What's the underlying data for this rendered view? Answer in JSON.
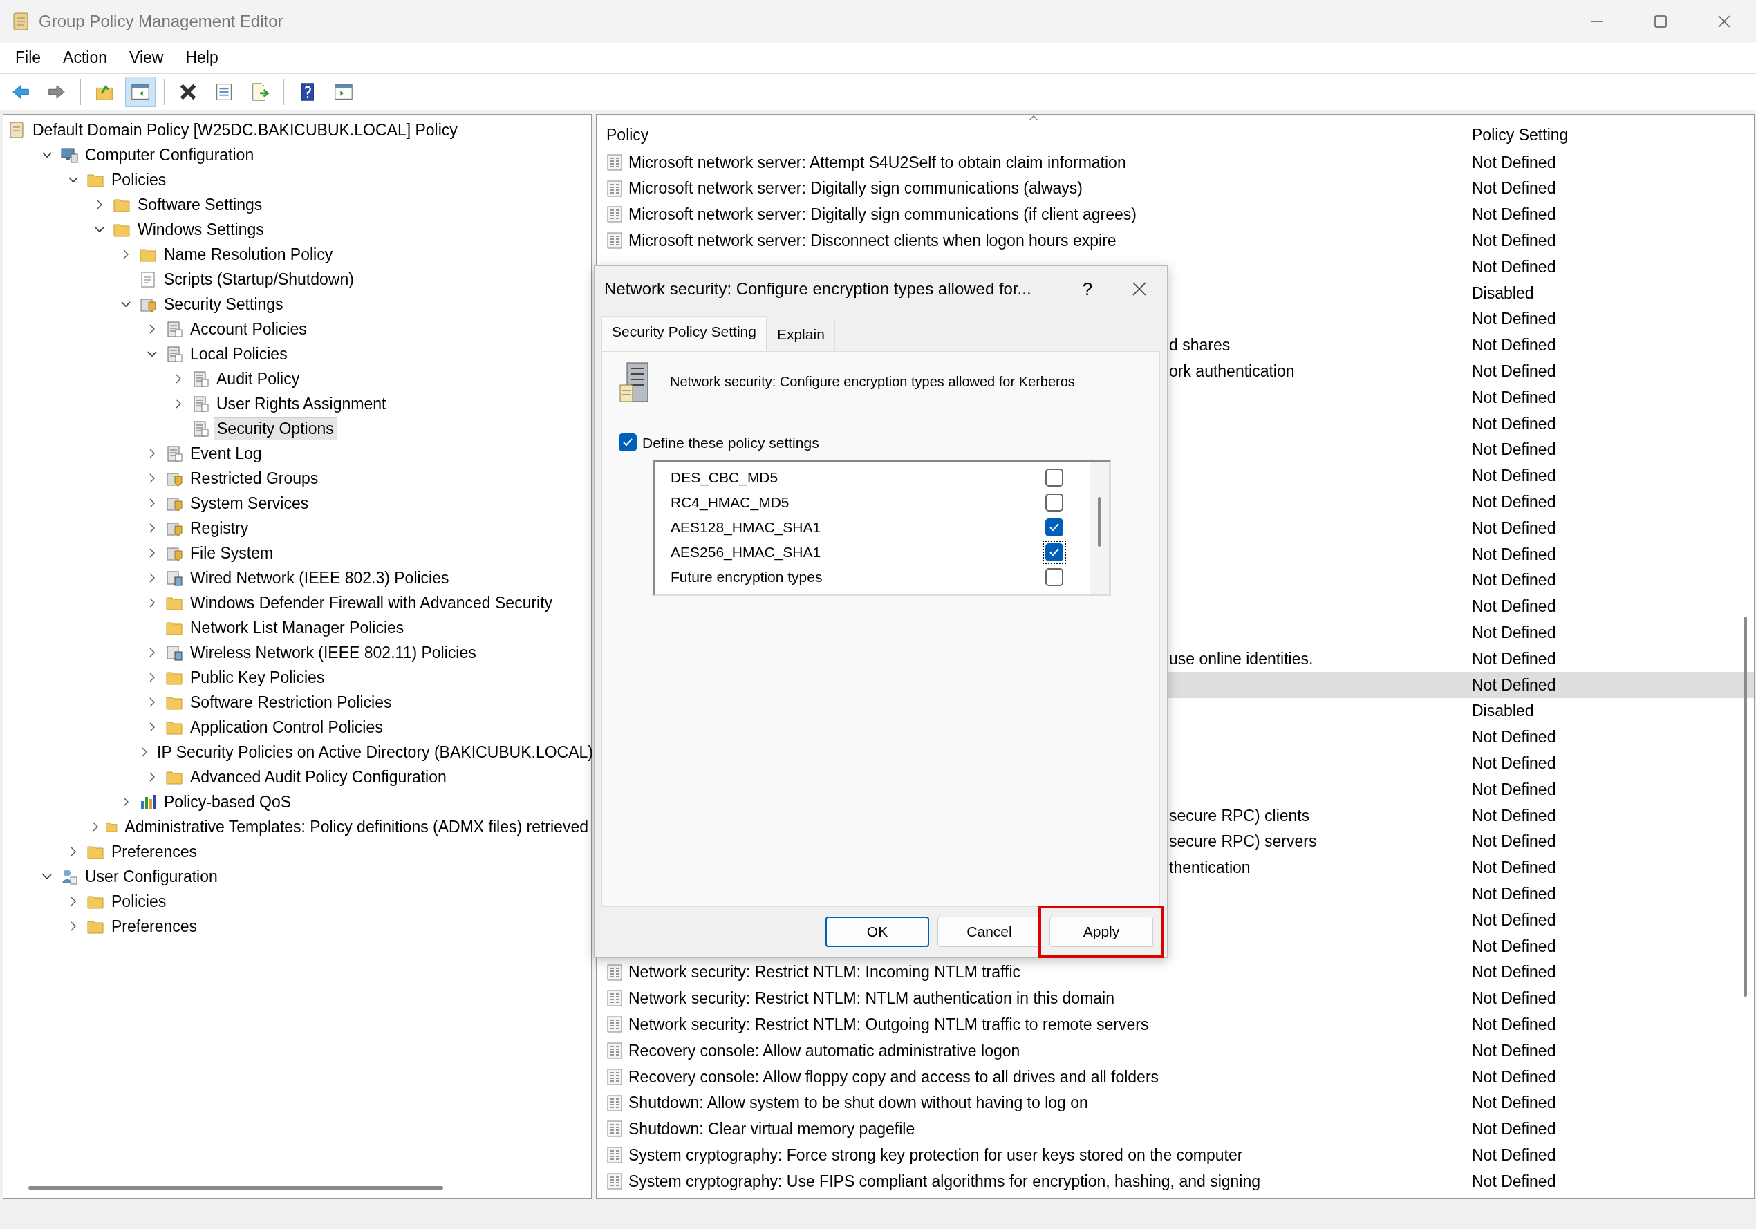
{
  "window": {
    "title": "Group Policy Management Editor"
  },
  "menu": [
    "File",
    "Action",
    "View",
    "Help"
  ],
  "toolbar": [
    {
      "kind": "back",
      "active": false
    },
    {
      "kind": "forward",
      "active": false
    },
    {
      "kind": "sep"
    },
    {
      "kind": "up",
      "active": false
    },
    {
      "kind": "tree",
      "active": true
    },
    {
      "kind": "sep"
    },
    {
      "kind": "delete",
      "active": false
    },
    {
      "kind": "properties",
      "active": false
    },
    {
      "kind": "export",
      "active": false
    },
    {
      "kind": "sep"
    },
    {
      "kind": "help",
      "active": false
    },
    {
      "kind": "pane",
      "active": false
    }
  ],
  "tree": [
    {
      "label": "Default Domain Policy [W25DC.BAKICUBUK.LOCAL] Policy",
      "kind": "scroll",
      "selected": false,
      "children": [
        {
          "label": "Computer Configuration",
          "kind": "computer",
          "expanded": true,
          "selected": false,
          "children": [
            {
              "label": "Policies",
              "kind": "folder",
              "expanded": true,
              "selected": false,
              "children": [
                {
                  "label": "Software Settings",
                  "kind": "folder",
                  "expanded": false,
                  "selected": false
                },
                {
                  "label": "Windows Settings",
                  "kind": "folder",
                  "expanded": true,
                  "selected": false,
                  "children": [
                    {
                      "label": "Name Resolution Policy",
                      "kind": "folder",
                      "expanded": false,
                      "selected": false
                    },
                    {
                      "label": "Scripts (Startup/Shutdown)",
                      "kind": "script",
                      "selected": false
                    },
                    {
                      "label": "Security Settings",
                      "kind": "security",
                      "expanded": true,
                      "selected": false,
                      "children": [
                        {
                          "label": "Account Policies",
                          "kind": "book",
                          "expanded": false,
                          "selected": false
                        },
                        {
                          "label": "Local Policies",
                          "kind": "book",
                          "expanded": true,
                          "selected": false,
                          "children": [
                            {
                              "label": "Audit Policy",
                              "kind": "book",
                              "expanded": false,
                              "selected": false
                            },
                            {
                              "label": "User Rights Assignment",
                              "kind": "book",
                              "expanded": false,
                              "selected": false
                            },
                            {
                              "label": "Security Options",
                              "kind": "book",
                              "selected": true
                            }
                          ]
                        },
                        {
                          "label": "Event Log",
                          "kind": "book",
                          "expanded": false,
                          "selected": false
                        },
                        {
                          "label": "Restricted Groups",
                          "kind": "security",
                          "expanded": false,
                          "selected": false
                        },
                        {
                          "label": "System Services",
                          "kind": "security",
                          "expanded": false,
                          "selected": false
                        },
                        {
                          "label": "Registry",
                          "kind": "security",
                          "expanded": false,
                          "selected": false
                        },
                        {
                          "label": "File System",
                          "kind": "security",
                          "expanded": false,
                          "selected": false
                        },
                        {
                          "label": "Wired Network (IEEE 802.3) Policies",
                          "kind": "network",
                          "expanded": false,
                          "selected": false
                        },
                        {
                          "label": "Windows Defender Firewall with Advanced Security",
                          "kind": "folder",
                          "expanded": false,
                          "selected": false
                        },
                        {
                          "label": "Network List Manager Policies",
                          "kind": "folder",
                          "selected": false
                        },
                        {
                          "label": "Wireless Network (IEEE 802.11) Policies",
                          "kind": "network",
                          "expanded": false,
                          "selected": false
                        },
                        {
                          "label": "Public Key Policies",
                          "kind": "folder",
                          "expanded": false,
                          "selected": false
                        },
                        {
                          "label": "Software Restriction Policies",
                          "kind": "folder",
                          "expanded": false,
                          "selected": false
                        },
                        {
                          "label": "Application Control Policies",
                          "kind": "folder",
                          "expanded": false,
                          "selected": false
                        },
                        {
                          "label": "IP Security Policies on Active Directory (BAKICUBUK.LOCAL)",
                          "kind": "ipsec",
                          "expanded": false,
                          "selected": false
                        },
                        {
                          "label": "Advanced Audit Policy Configuration",
                          "kind": "folder",
                          "expanded": false,
                          "selected": false
                        }
                      ]
                    },
                    {
                      "label": "Policy-based QoS",
                      "kind": "qos",
                      "expanded": false,
                      "selected": false
                    }
                  ]
                },
                {
                  "label": "Administrative Templates: Policy definitions (ADMX files) retrieved",
                  "kind": "folder",
                  "expanded": false,
                  "selected": false
                }
              ]
            },
            {
              "label": "Preferences",
              "kind": "folder",
              "expanded": false,
              "selected": false
            }
          ]
        },
        {
          "label": "User Configuration",
          "kind": "user",
          "expanded": true,
          "selected": false,
          "children": [
            {
              "label": "Policies",
              "kind": "folder",
              "expanded": false,
              "selected": false
            },
            {
              "label": "Preferences",
              "kind": "folder",
              "expanded": false,
              "selected": false
            }
          ]
        }
      ]
    }
  ],
  "table": {
    "columns": [
      "Policy",
      "Policy Setting"
    ],
    "rows": [
      {
        "policy": "Microsoft network server: Attempt S4U2Self to obtain claim information",
        "partial": false,
        "setting": "Not Defined",
        "selected": false
      },
      {
        "policy": "Microsoft network server: Digitally sign communications (always)",
        "partial": false,
        "setting": "Not Defined",
        "selected": false
      },
      {
        "policy": "Microsoft network server: Digitally sign communications (if client agrees)",
        "partial": false,
        "setting": "Not Defined",
        "selected": false
      },
      {
        "policy": "Microsoft network server: Disconnect clients when logon hours expire",
        "partial": false,
        "setting": "Not Defined",
        "selected": false
      },
      {
        "setting": "Not Defined",
        "selected": false
      },
      {
        "setting": "Disabled",
        "selected": false
      },
      {
        "setting": "Not Defined",
        "selected": false
      },
      {
        "policy": "d shares",
        "partial": true,
        "setting": "Not Defined",
        "selected": false
      },
      {
        "policy": "ork authentication",
        "partial": true,
        "setting": "Not Defined",
        "selected": false
      },
      {
        "setting": "Not Defined",
        "selected": false
      },
      {
        "setting": "Not Defined",
        "selected": false
      },
      {
        "setting": "Not Defined",
        "selected": false
      },
      {
        "setting": "Not Defined",
        "selected": false
      },
      {
        "setting": "Not Defined",
        "selected": false
      },
      {
        "setting": "Not Defined",
        "selected": false
      },
      {
        "setting": "Not Defined",
        "selected": false
      },
      {
        "setting": "Not Defined",
        "selected": false
      },
      {
        "setting": "Not Defined",
        "selected": false
      },
      {
        "setting": "Not Defined",
        "selected": false
      },
      {
        "policy": "use online identities.",
        "partial": true,
        "setting": "Not Defined",
        "selected": false
      },
      {
        "setting": "Not Defined",
        "selected": true
      },
      {
        "setting": "Disabled",
        "selected": false
      },
      {
        "setting": "Not Defined",
        "selected": false
      },
      {
        "setting": "Not Defined",
        "selected": false
      },
      {
        "setting": "Not Defined",
        "selected": false
      },
      {
        "policy": "secure RPC) clients",
        "partial": true,
        "setting": "Not Defined",
        "selected": false
      },
      {
        "policy": "secure RPC) servers",
        "partial": true,
        "setting": "Not Defined",
        "selected": false
      },
      {
        "policy": "thentication",
        "partial": true,
        "setting": "Not Defined",
        "selected": false
      },
      {
        "setting": "Not Defined",
        "selected": false
      },
      {
        "setting": "Not Defined",
        "selected": false
      },
      {
        "setting": "Not Defined",
        "selected": false
      },
      {
        "policy": "Network security: Restrict NTLM: Incoming NTLM traffic",
        "partial": false,
        "setting": "Not Defined",
        "selected": false
      },
      {
        "policy": "Network security: Restrict NTLM: NTLM authentication in this domain",
        "partial": false,
        "setting": "Not Defined",
        "selected": false
      },
      {
        "policy": "Network security: Restrict NTLM: Outgoing NTLM traffic to remote servers",
        "partial": false,
        "setting": "Not Defined",
        "selected": false
      },
      {
        "policy": "Recovery console: Allow automatic administrative logon",
        "partial": false,
        "setting": "Not Defined",
        "selected": false
      },
      {
        "policy": "Recovery console: Allow floppy copy and access to all drives and all folders",
        "partial": false,
        "setting": "Not Defined",
        "selected": false
      },
      {
        "policy": "Shutdown: Allow system to be shut down without having to log on",
        "partial": false,
        "setting": "Not Defined",
        "selected": false
      },
      {
        "policy": "Shutdown: Clear virtual memory pagefile",
        "partial": false,
        "setting": "Not Defined",
        "selected": false
      },
      {
        "policy": "System cryptography: Force strong key protection for user keys stored on the computer",
        "partial": false,
        "setting": "Not Defined",
        "selected": false
      },
      {
        "policy": "System cryptography: Use FIPS compliant algorithms for encryption, hashing, and signing",
        "partial": false,
        "setting": "Not Defined",
        "selected": false
      }
    ]
  },
  "dialog": {
    "title": "Network security: Configure encryption types allowed for...",
    "help": "?",
    "tabs": [
      {
        "label": "Security Policy Setting",
        "selected": true
      },
      {
        "label": "Explain",
        "selected": false
      }
    ],
    "description": "Network security: Configure encryption types allowed for Kerberos",
    "define": {
      "label": "Define these policy settings",
      "checked": true
    },
    "options": [
      {
        "label": "DES_CBC_MD5",
        "checked": false,
        "focused": false
      },
      {
        "label": "RC4_HMAC_MD5",
        "checked": false,
        "focused": false
      },
      {
        "label": "AES128_HMAC_SHA1",
        "checked": true,
        "focused": false
      },
      {
        "label": "AES256_HMAC_SHA1",
        "checked": true,
        "focused": true
      },
      {
        "label": "Future encryption types",
        "checked": false,
        "focused": false
      }
    ],
    "buttons": [
      {
        "label": "OK",
        "default": true,
        "highlighted": false
      },
      {
        "label": "Cancel",
        "default": false,
        "highlighted": false
      },
      {
        "label": "Apply",
        "default": false,
        "highlighted": true
      }
    ]
  }
}
